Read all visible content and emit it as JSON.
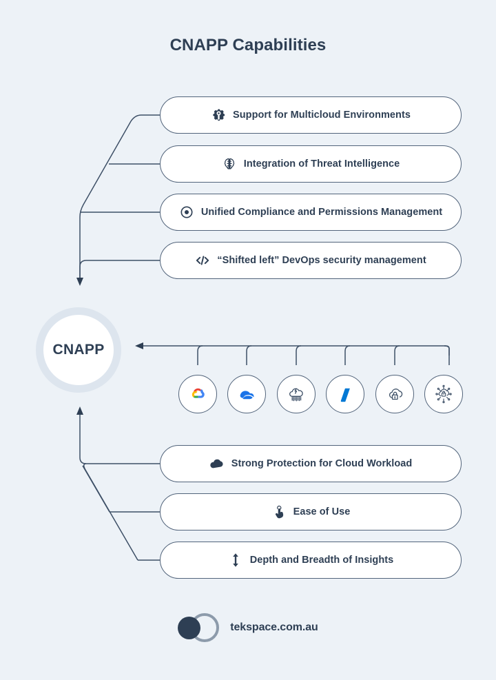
{
  "page": {
    "title": "CNAPP Capabilities",
    "background_color": "#edf2f7",
    "text_color": "#2e3f54",
    "line_color": "#3d4f66"
  },
  "center_node": {
    "label": "CNAPP",
    "ring_color": "#dde5ee"
  },
  "top_capabilities": [
    {
      "label": "Support for Multicloud Environments",
      "icon": "gear-wrench-icon"
    },
    {
      "label": "Integration of Threat Intelligence",
      "icon": "brain-icon"
    },
    {
      "label": "Unified Compliance and Permissions Management",
      "icon": "target-icon"
    },
    {
      "label": "“Shifted left” DevOps security management",
      "icon": "code-tag-icon"
    }
  ],
  "bottom_capabilities": [
    {
      "label": "Strong Protection for Cloud Workload",
      "icon": "cloud-filled-icon"
    },
    {
      "label": "Ease of Use",
      "icon": "pointing-hand-icon"
    },
    {
      "label": "Depth and Breadth of Insights",
      "icon": "vertical-double-arrow-icon"
    }
  ],
  "platforms": [
    {
      "name": "google-cloud-icon"
    },
    {
      "name": "blue-cloud-icon"
    },
    {
      "name": "rain-cloud-icon"
    },
    {
      "name": "azure-icon"
    },
    {
      "name": "cloud-lock-icon"
    },
    {
      "name": "network-lock-icon"
    }
  ],
  "footer": {
    "wordmark": "tekspace.com.au",
    "mark_disc_color": "#2e3f54",
    "mark_ring_color": "#8d9bab"
  }
}
